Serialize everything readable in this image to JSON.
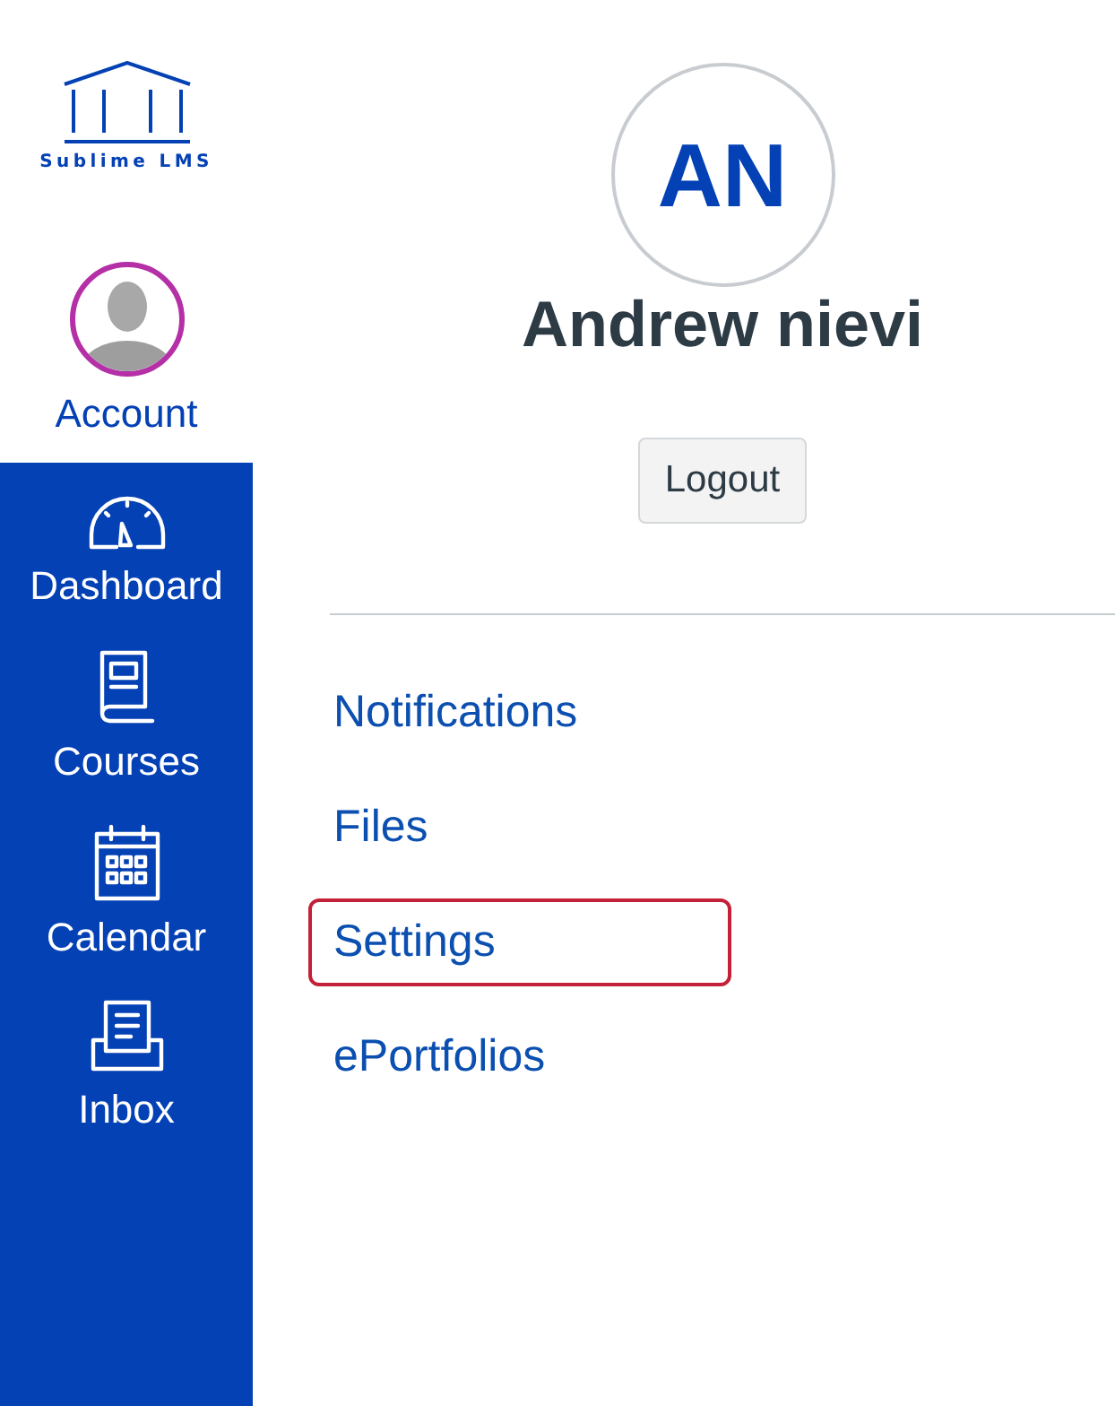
{
  "logo": {
    "text": "Sublime LMS"
  },
  "nav": [
    {
      "kind": "account",
      "label": "Account",
      "selected": true
    },
    {
      "kind": "dashboard",
      "label": "Dashboard",
      "selected": false
    },
    {
      "kind": "courses",
      "label": "Courses",
      "selected": false
    },
    {
      "kind": "calendar",
      "label": "Calendar",
      "selected": false
    },
    {
      "kind": "inbox",
      "label": "Inbox",
      "selected": false
    }
  ],
  "profile": {
    "initials": "AN",
    "name": "Andrew nievi",
    "logout": "Logout"
  },
  "links": [
    {
      "label": "Notifications",
      "highlighted": false
    },
    {
      "label": "Files",
      "highlighted": false
    },
    {
      "label": "Settings",
      "highlighted": true
    },
    {
      "label": "ePortfolios",
      "highlighted": false
    }
  ]
}
